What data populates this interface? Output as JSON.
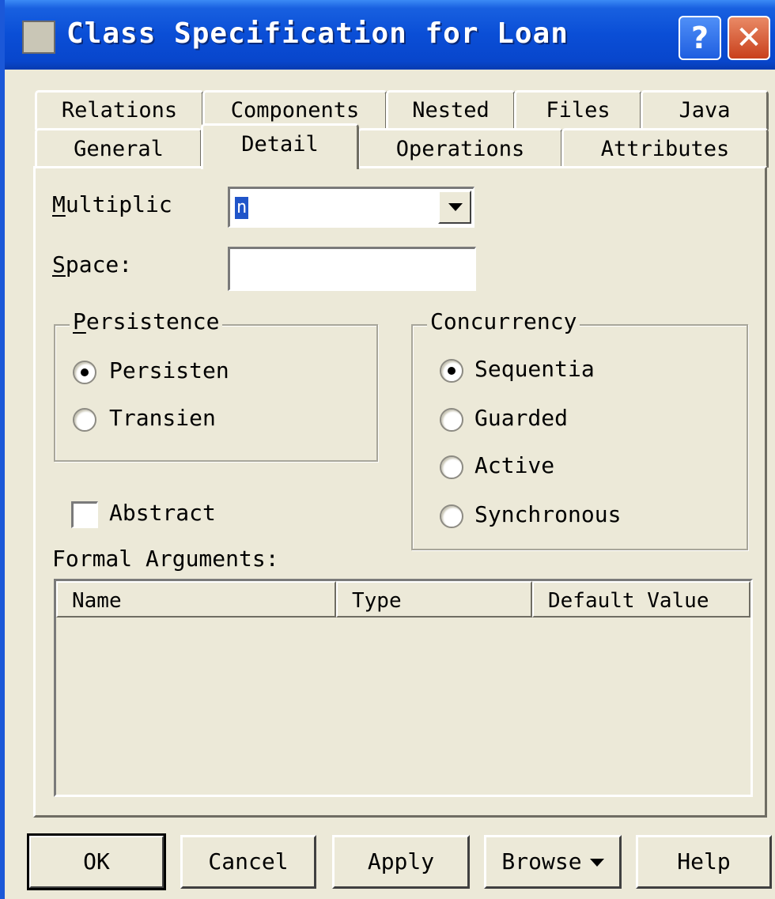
{
  "window": {
    "title": "Class Specification for Loan",
    "help_glyph": "?",
    "close_glyph": "✕"
  },
  "tabs": {
    "row1": [
      "Relations",
      "Components",
      "Nested",
      "Files",
      "Java"
    ],
    "row2": [
      "General",
      "Detail",
      "Operations",
      "Attributes"
    ],
    "active": "Detail"
  },
  "detail": {
    "multiplicity": {
      "label": "Multiplic",
      "value": "n"
    },
    "space": {
      "label": "Space:",
      "value": ""
    },
    "persistence": {
      "legend": "Persistence",
      "options": [
        {
          "label": "Persisten",
          "checked": true
        },
        {
          "label": "Transien",
          "checked": false
        }
      ]
    },
    "concurrency": {
      "legend": "Concurrency",
      "options": [
        {
          "label": "Sequentia",
          "checked": true
        },
        {
          "label": "Guarded",
          "checked": false
        },
        {
          "label": "Active",
          "checked": false
        },
        {
          "label": "Synchronous",
          "checked": false
        }
      ]
    },
    "abstract": {
      "label": "Abstract",
      "checked": false
    },
    "formal_arguments": {
      "label": "Formal Arguments:",
      "columns": [
        "Name",
        "Type",
        "Default Value"
      ],
      "rows": []
    }
  },
  "buttons": {
    "ok": "OK",
    "cancel": "Cancel",
    "apply": "Apply",
    "browse": "Browse",
    "help": "Help"
  }
}
